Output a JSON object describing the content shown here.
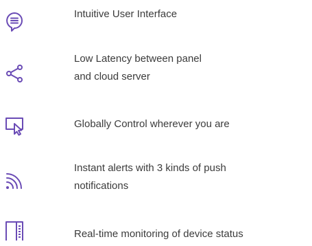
{
  "accent_color": "#6a4bb5",
  "features": [
    {
      "icon": "chat-bubble-icon",
      "lines": [
        "Intuitive User Interface"
      ]
    },
    {
      "icon": "share-icon",
      "lines": [
        "Low Latency between panel",
        "and cloud server"
      ]
    },
    {
      "icon": "monitor-cursor-icon",
      "lines": [
        "Globally Control wherever you are"
      ]
    },
    {
      "icon": "rss-feed-icon",
      "lines": [
        "Instant alerts with 3 kinds of push",
        "notifications"
      ]
    },
    {
      "icon": "device-panel-icon",
      "lines": [
        "Real-time monitoring of device status"
      ]
    }
  ]
}
